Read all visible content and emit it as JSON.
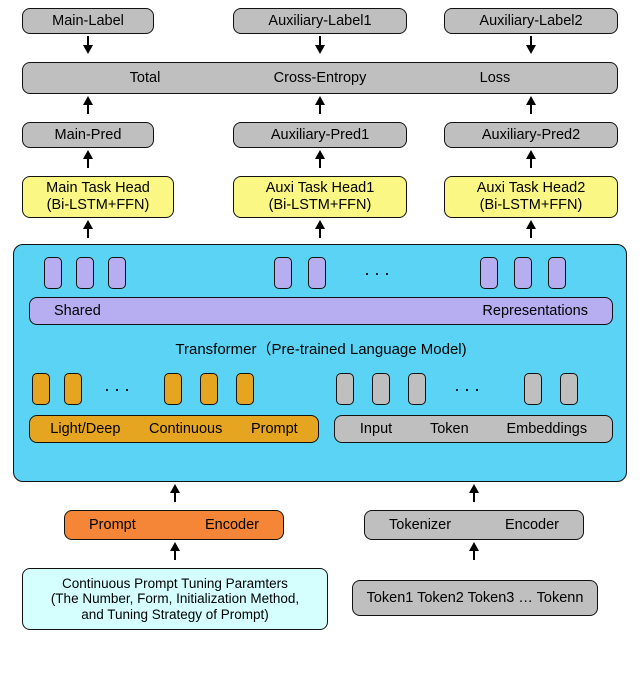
{
  "labels": {
    "main": "Main-Label",
    "aux1": "Auxiliary-Label1",
    "aux2": "Auxiliary-Label2"
  },
  "loss": {
    "w1": "Total",
    "w2": "Cross-Entropy",
    "w3": "Loss"
  },
  "preds": {
    "main": "Main-Pred",
    "aux1": "Auxiliary-Pred1",
    "aux2": "Auxiliary-Pred2"
  },
  "heads": {
    "main": "Main Task Head\n(Bi-LSTM+FFN)",
    "aux1": "Auxi Task Head1\n(Bi-LSTM+FFN)",
    "aux2": "Auxi Task Head2\n(Bi-LSTM+FFN)"
  },
  "transformer": {
    "title": "Transformer（Pre-trained Language Model)",
    "shared": {
      "w1": "Shared",
      "w2": "Representations"
    },
    "prompt": {
      "w1": "Light/Deep",
      "w2": "Continuous",
      "w3": "Prompt"
    },
    "input": {
      "w1": "Input",
      "w2": "Token",
      "w3": "Embeddings"
    }
  },
  "encoders": {
    "prompt": {
      "w1": "Prompt",
      "w2": "Encoder"
    },
    "tokenizer": {
      "w1": "Tokenizer",
      "w2": "Encoder"
    }
  },
  "bottom": {
    "params": "Continuous Prompt Tuning Paramters\n(The Number, Form, Initialization Method,\nand Tuning Strategy of Prompt)",
    "tokens": "Token1 Token2 Token3 … Tokenn"
  }
}
